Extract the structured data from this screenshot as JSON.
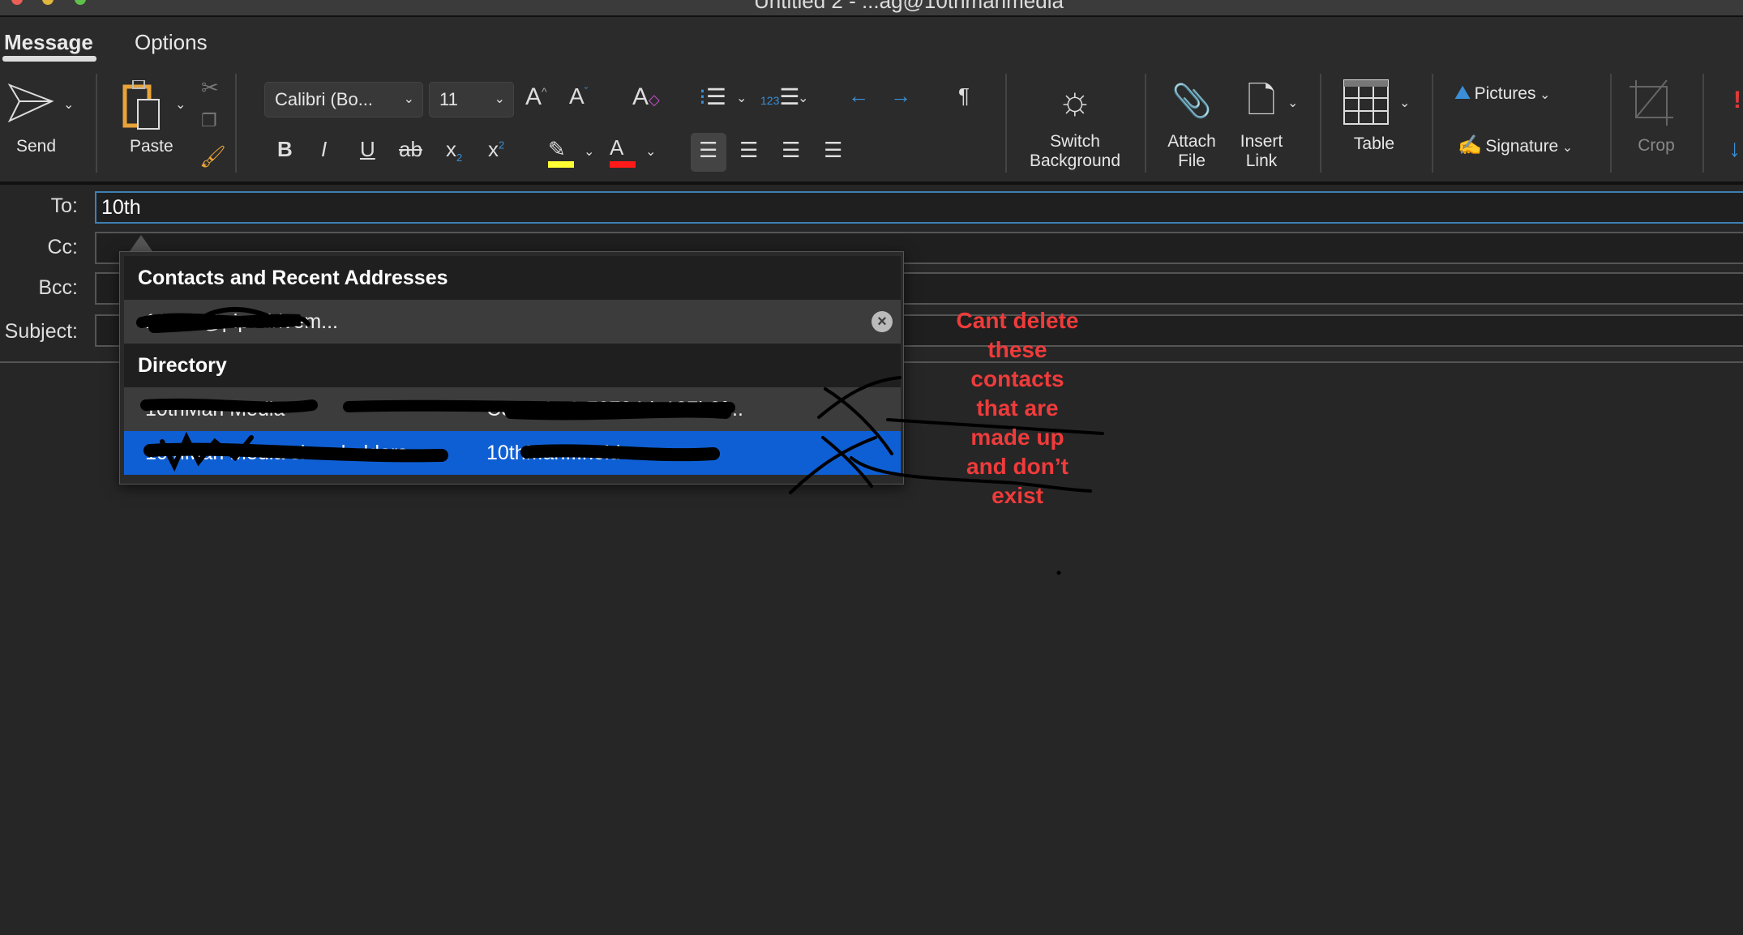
{
  "window": {
    "title": "Untitled 2 - ...ag@10thmanmedia"
  },
  "tabs": [
    {
      "label": "Message",
      "active": true
    },
    {
      "label": "Options",
      "active": false
    }
  ],
  "ribbon": {
    "send": "Send",
    "paste": "Paste",
    "font_name": "Calibri (Bo...",
    "font_size": "11",
    "switch_background": "Switch Background",
    "attach_file": "Attach File",
    "insert_link": "Insert Link",
    "table": "Table",
    "pictures": "Pictures",
    "signature": "Signature",
    "crop": "Crop",
    "highlight_color": "#ffff33",
    "font_color": "#ff1a1a",
    "accent": "#3a8fd6"
  },
  "fields": {
    "to_label": "To:",
    "to_value": "10th",
    "cc_label": "Cc:",
    "bcc_label": "Bcc:",
    "subject_label": "Subject:"
  },
  "autocomplete": {
    "section1": "Contacts and Recent Addresses",
    "recent": [
      {
        "name": "10th...@pipedrivem..."
      }
    ],
    "section2": "Directory",
    "directory": [
      {
        "name": "10thMan Media",
        "email": "Cee3ab40-70724dc107b0f...",
        "selected": false
      },
      {
        "name": "10thMan Media shareholders",
        "email": "10thMan...holders...",
        "selected": true
      }
    ],
    "selected_color": "#0f5fd4"
  },
  "annotation": {
    "lines": [
      "Cant delete",
      "these",
      "contacts",
      "that are",
      "made up",
      "and don’t",
      "exist"
    ],
    "color": "#ef3b3b"
  }
}
